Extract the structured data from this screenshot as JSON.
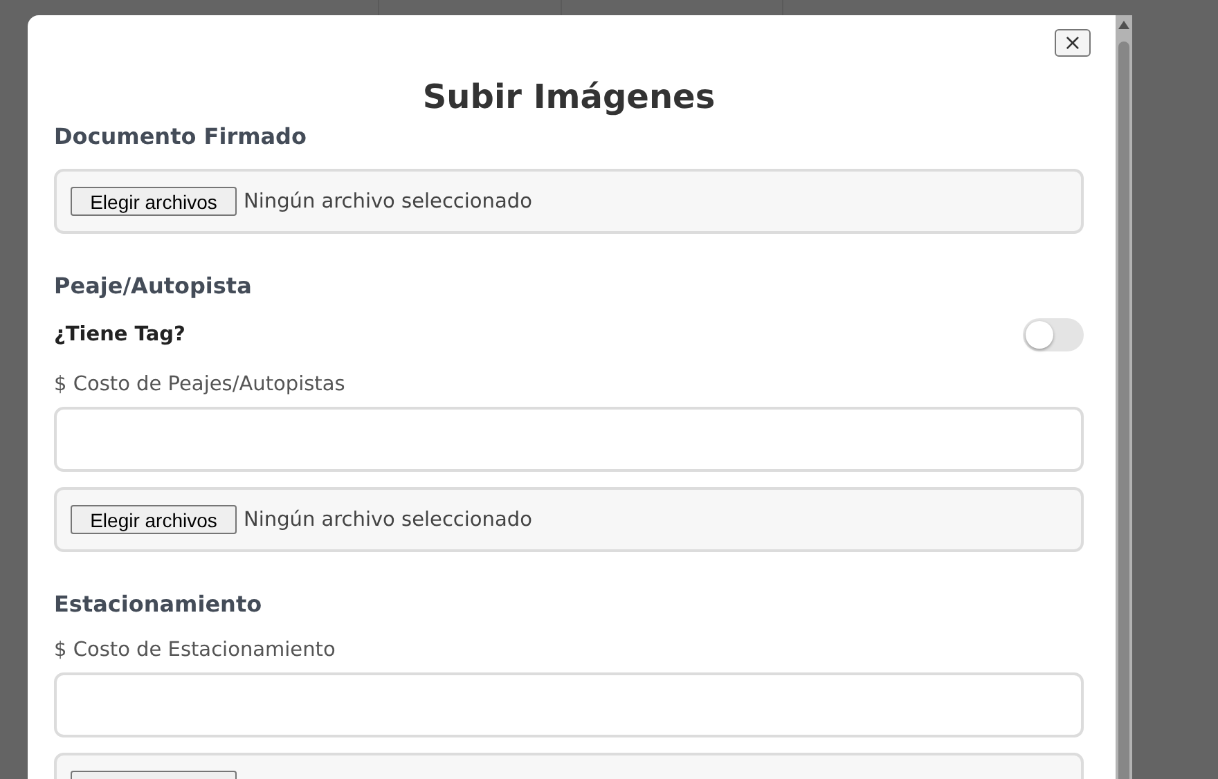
{
  "dialog": {
    "title": "Subir Imágenes",
    "close": "×"
  },
  "sections": [
    {
      "heading": "Documento Firmado",
      "fields": [
        {
          "kind": "file",
          "button": "Elegir archivos",
          "status": "Ningún archivo seleccionado"
        }
      ]
    },
    {
      "heading": "Peaje/Autopista",
      "fields": [
        {
          "kind": "toggle",
          "label": "¿Tiene Tag?",
          "on": false
        },
        {
          "kind": "text",
          "label": "$ Costo de Peajes/Autopistas"
        },
        {
          "kind": "file",
          "button": "Elegir archivos",
          "status": "Ningún archivo seleccionado"
        }
      ]
    },
    {
      "heading": "Estacionamiento",
      "fields": [
        {
          "kind": "text",
          "label": "$ Costo de Estacionamiento"
        },
        {
          "kind": "file"
        }
      ]
    }
  ]
}
